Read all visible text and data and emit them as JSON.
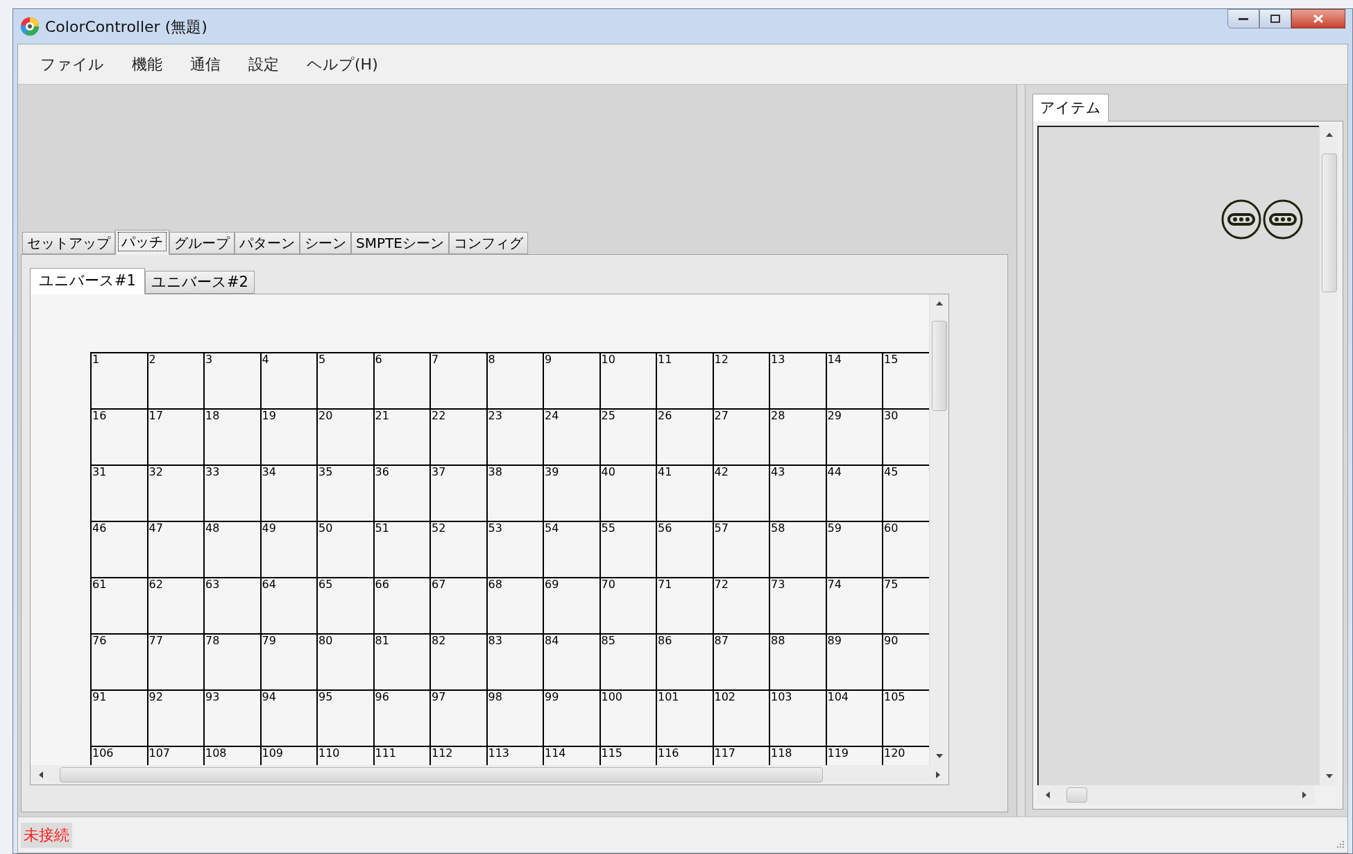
{
  "window": {
    "title": "ColorController (無題)"
  },
  "menu": [
    {
      "label": "ファイル"
    },
    {
      "label": "機能"
    },
    {
      "label": "通信"
    },
    {
      "label": "設定"
    },
    {
      "label": "ヘルプ(H)"
    }
  ],
  "tabs": [
    {
      "label": "セットアップ",
      "selected": false
    },
    {
      "label": "パッチ",
      "selected": true
    },
    {
      "label": "グループ",
      "selected": false
    },
    {
      "label": "パターン",
      "selected": false
    },
    {
      "label": "シーン",
      "selected": false
    },
    {
      "label": "SMPTEシーン",
      "selected": false
    },
    {
      "label": "コンフィグ",
      "selected": false
    }
  ],
  "sub_tabs": [
    {
      "label": "ユニバース#1",
      "selected": true
    },
    {
      "label": "ユニバース#2",
      "selected": false
    }
  ],
  "patch_grid": {
    "cells": [
      "1",
      "2",
      "3",
      "4",
      "5",
      "6",
      "7",
      "8",
      "9",
      "10",
      "11",
      "12",
      "13",
      "14",
      "15",
      "16",
      "17",
      "18",
      "19",
      "20",
      "21",
      "22",
      "23",
      "24",
      "25",
      "26",
      "27",
      "28",
      "29",
      "30",
      "31",
      "32",
      "33",
      "34",
      "35",
      "36",
      "37",
      "38",
      "39",
      "40",
      "41",
      "42",
      "43",
      "44",
      "45",
      "46",
      "47",
      "48",
      "49",
      "50",
      "51",
      "52",
      "53",
      "54",
      "55",
      "56",
      "57",
      "58",
      "59",
      "60",
      "61",
      "62",
      "63",
      "64",
      "65",
      "66",
      "67",
      "68",
      "69",
      "70",
      "71",
      "72",
      "73",
      "74",
      "75",
      "76",
      "77",
      "78",
      "79",
      "80",
      "81",
      "82",
      "83",
      "84",
      "85",
      "86",
      "87",
      "88",
      "89",
      "90",
      "91",
      "92",
      "93",
      "94",
      "95",
      "96",
      "97",
      "98",
      "99",
      "100",
      "101",
      "102",
      "103",
      "104",
      "105",
      "106",
      "107",
      "108",
      "109",
      "110",
      "111",
      "112",
      "113",
      "114",
      "115",
      "116",
      "117",
      "118",
      "119",
      "120"
    ]
  },
  "item_panel": {
    "tabs": [
      {
        "label": "アイテム",
        "selected": true
      }
    ]
  },
  "status_bar": {
    "text": "未接続"
  }
}
